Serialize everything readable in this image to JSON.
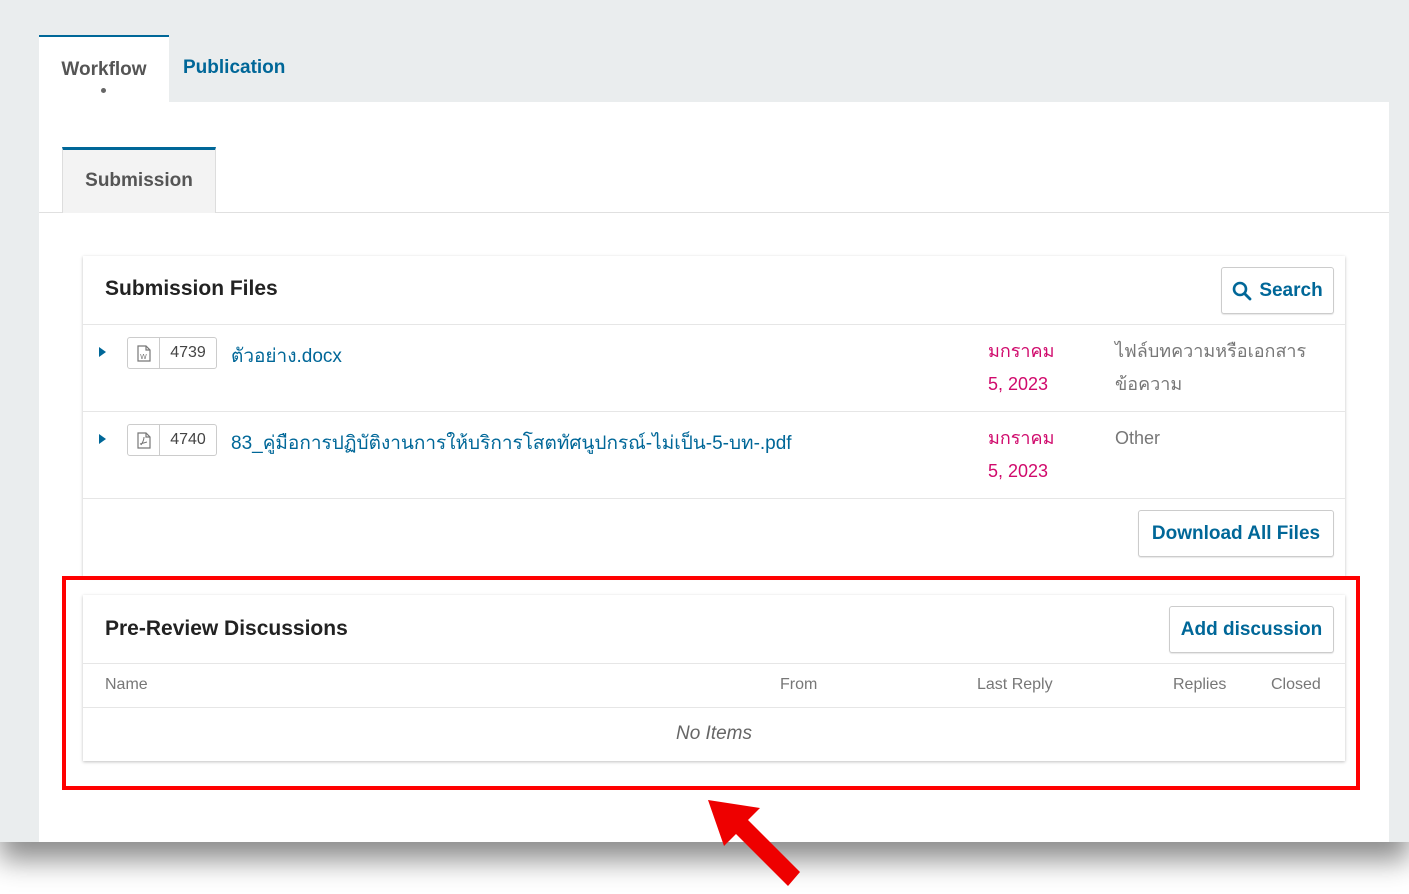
{
  "tabs": {
    "workflow": "Workflow",
    "publication": "Publication"
  },
  "subtab": {
    "submission": "Submission"
  },
  "files": {
    "title": "Submission Files",
    "search_label": "Search",
    "rows": [
      {
        "id": "4739",
        "name": "ตัวอย่าง.docx",
        "date_line1": "มกราคม",
        "date_line2": "5, 2023",
        "type_line1": "ไฟล์บทความหรือเอกสาร",
        "type_line2": "ข้อความ",
        "icon": "word-file-icon"
      },
      {
        "id": "4740",
        "name": "83_คู่มือการปฏิบัติงานการให้บริการโสตทัศนูปกรณ์-ไม่เป็น-5-บท-.pdf",
        "date_line1": "มกราคม",
        "date_line2": "5, 2023",
        "type_line1": "Other",
        "type_line2": "",
        "icon": "pdf-file-icon"
      }
    ],
    "download_all_label": "Download All Files"
  },
  "discussions": {
    "title": "Pre-Review Discussions",
    "add_label": "Add discussion",
    "columns": {
      "name": "Name",
      "from": "From",
      "last_reply": "Last Reply",
      "replies": "Replies",
      "closed": "Closed"
    },
    "empty_text": "No Items"
  },
  "colors": {
    "accent": "#006798",
    "date": "#d00a6c",
    "highlight": "#ff0000"
  }
}
